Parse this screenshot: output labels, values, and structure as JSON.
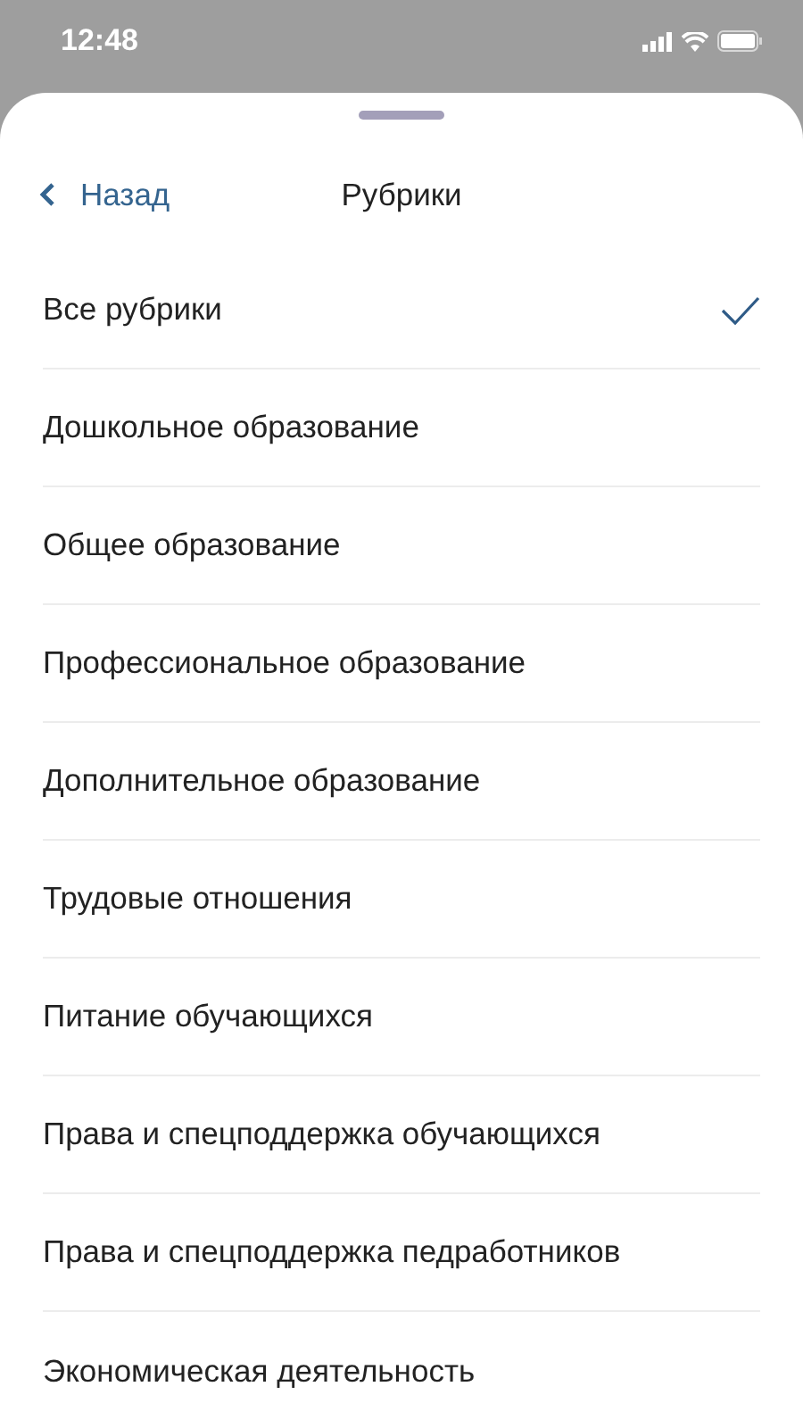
{
  "status_bar": {
    "time": "12:48"
  },
  "header": {
    "back": "Назад",
    "title": "Рубрики"
  },
  "items": [
    {
      "label": "Все рубрики",
      "selected": true
    },
    {
      "label": "Дошкольное образование",
      "selected": false
    },
    {
      "label": "Общее образование",
      "selected": false
    },
    {
      "label": "Профессиональное образование",
      "selected": false
    },
    {
      "label": "Дополнительное образование",
      "selected": false
    },
    {
      "label": "Трудовые отношения",
      "selected": false
    },
    {
      "label": "Питание обучающихся",
      "selected": false
    },
    {
      "label": "Права и спецподдержка обучающихся",
      "selected": false
    },
    {
      "label": "Права и спецподдержка педработников",
      "selected": false
    },
    {
      "label": "Экономическая деятельность",
      "selected": false
    }
  ]
}
